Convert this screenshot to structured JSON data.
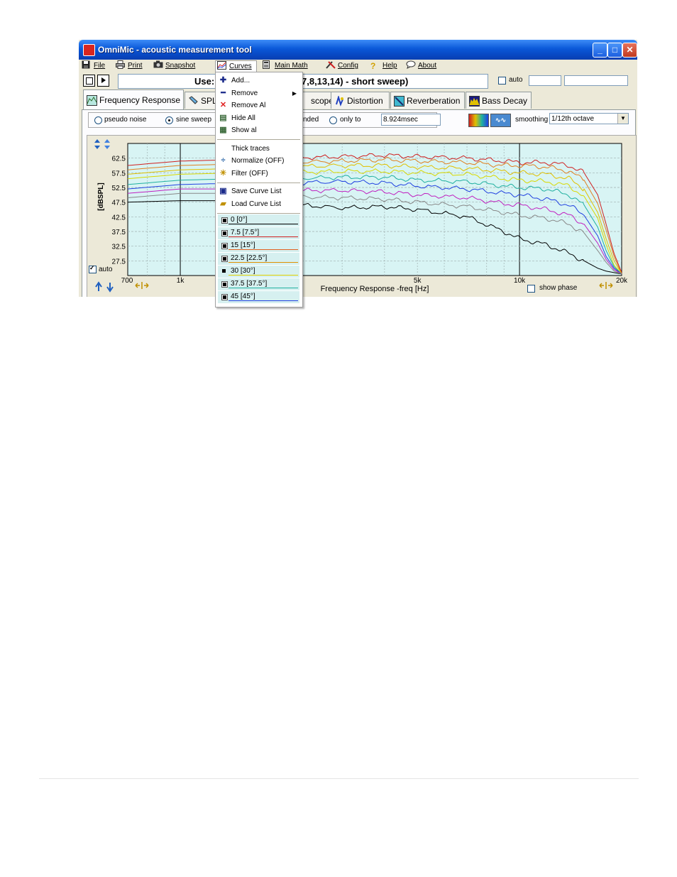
{
  "window": {
    "title": "OmniMic - acoustic measurement tool",
    "controls": {
      "minimize": "_",
      "maximize": "□",
      "close": "✕"
    }
  },
  "menubar": {
    "items": [
      {
        "label": "File",
        "icon": "disk-icon"
      },
      {
        "label": "Print",
        "icon": "printer-icon"
      },
      {
        "label": "Snapshot",
        "icon": "camera-icon"
      },
      {
        "label": "Curves",
        "icon": "curves-icon"
      },
      {
        "label": "Main Math",
        "icon": "calculator-icon"
      },
      {
        "label": "Config",
        "icon": "tools-icon"
      },
      {
        "label": "Help",
        "icon": "question-icon"
      },
      {
        "label": "About",
        "icon": "speech-bubble-icon"
      }
    ]
  },
  "toolbar": {
    "status_left": "Use:",
    "status_right": "7,8,13,14) - short sweep)",
    "auto_label": "auto"
  },
  "tabs": [
    {
      "label": "Frequency Response",
      "active": true
    },
    {
      "label": "SPL"
    },
    {
      "label": "scope"
    },
    {
      "label": "Distortion"
    },
    {
      "label": "Reverberation"
    },
    {
      "label": "Bass Decay"
    }
  ],
  "options": {
    "pseudo_noise": "pseudo noise",
    "sine_sweep": "sine sweep",
    "ded": "nded",
    "only_to": "only to",
    "time_value": "8.924msec",
    "smoothing_label": "smoothing",
    "smoothing_value": "1/12th octave"
  },
  "chart": {
    "auto_label": "auto",
    "show_phase": "show phase",
    "start_label": "700"
  },
  "chart_data": {
    "type": "line",
    "title": "",
    "xlabel": "Frequency Response -freq [Hz]",
    "ylabel": "[dBSPL]",
    "x_scale": "log",
    "xlim": [
      700,
      20000
    ],
    "ylim": [
      22.5,
      67.5
    ],
    "x_ticks": [
      {
        "value": 1000,
        "label": "1k"
      },
      {
        "value": 5000,
        "label": "5k"
      },
      {
        "value": 10000,
        "label": "10k"
      },
      {
        "value": 20000,
        "label": "20k"
      }
    ],
    "y_ticks": [
      62.5,
      57.5,
      52.5,
      47.5,
      42.5,
      37.5,
      32.5,
      27.5
    ],
    "grid": true,
    "x": [
      700,
      1000,
      1500,
      2000,
      3000,
      4000,
      5000,
      7000,
      9000,
      10000,
      12000,
      14000,
      15500,
      17000,
      18000,
      19000,
      20000
    ],
    "series": [
      {
        "name": "0 [0°]",
        "color": "#000000",
        "values": [
          47.5,
          48.0,
          48.0,
          47.0,
          45.5,
          46.0,
          45.0,
          42.5,
          37.5,
          35.0,
          33.0,
          30.0,
          27.5,
          25.0,
          24.0,
          23.5,
          23.0
        ]
      },
      {
        "name": "7.5 [7.5°]",
        "color": "#d02020",
        "values": [
          60.0,
          61.5,
          62.0,
          62.5,
          63.0,
          63.5,
          63.0,
          62.5,
          61.5,
          61.0,
          61.0,
          60.0,
          57.5,
          50.0,
          40.0,
          30.0,
          23.5
        ]
      },
      {
        "name": "15 [15°]",
        "color": "#e08020",
        "values": [
          58.5,
          60.0,
          60.5,
          61.0,
          61.5,
          62.0,
          61.5,
          61.0,
          60.0,
          60.0,
          59.5,
          58.0,
          55.0,
          47.0,
          38.0,
          29.0,
          23.0
        ]
      },
      {
        "name": "22.5 [22.5°]",
        "color": "#e0c000",
        "values": [
          57.0,
          58.5,
          59.0,
          59.5,
          60.0,
          60.0,
          59.5,
          59.0,
          58.0,
          57.5,
          57.0,
          55.5,
          52.0,
          44.0,
          35.0,
          27.5,
          23.0
        ]
      },
      {
        "name": "30 [30°]",
        "color": "#d8d800",
        "values": [
          55.5,
          57.0,
          57.5,
          57.5,
          58.0,
          58.0,
          57.5,
          57.0,
          55.5,
          55.0,
          54.5,
          53.0,
          49.5,
          42.0,
          33.0,
          26.0,
          23.0
        ]
      },
      {
        "name": "37.5 [37.5°]",
        "color": "#20b0a0",
        "values": [
          53.5,
          55.0,
          55.5,
          55.5,
          56.0,
          56.0,
          55.0,
          54.5,
          53.0,
          52.5,
          52.0,
          50.0,
          46.5,
          39.0,
          31.0,
          25.5,
          23.0
        ]
      },
      {
        "name": "45 [45°]",
        "color": "#2040e0",
        "values": [
          52.0,
          53.5,
          54.0,
          54.0,
          54.5,
          54.0,
          53.0,
          52.0,
          50.5,
          50.0,
          48.5,
          46.5,
          43.0,
          36.0,
          29.0,
          25.0,
          23.0
        ]
      },
      {
        "name": "",
        "color": "#c020c0",
        "values": [
          50.5,
          52.0,
          52.0,
          51.5,
          51.5,
          51.0,
          50.0,
          49.0,
          47.0,
          46.5,
          45.0,
          43.0,
          40.0,
          33.5,
          28.0,
          24.5,
          23.0
        ]
      },
      {
        "name": "",
        "color": "#888888",
        "values": [
          49.0,
          50.5,
          50.5,
          49.5,
          49.0,
          48.5,
          47.5,
          46.0,
          44.0,
          43.0,
          42.0,
          40.0,
          37.0,
          31.0,
          27.0,
          24.0,
          23.0
        ]
      }
    ]
  },
  "curves_menu": {
    "items": [
      {
        "label": "Add...",
        "icon": "plus-icon",
        "glyph": "✚",
        "color": "#1a2a8a"
      },
      {
        "label": "Remove",
        "icon": "minus-icon",
        "glyph": "━",
        "color": "#1a2a8a",
        "submenu": true
      },
      {
        "label": "Remove Al",
        "icon": "red-x-icon",
        "glyph": "✕",
        "color": "#e02020"
      },
      {
        "label": "Hide All",
        "icon": "hide-all-icon",
        "glyph": "▤",
        "color": "#3a6a3a"
      },
      {
        "label": "Show al",
        "icon": "show-all-icon",
        "glyph": "▦",
        "color": "#3a6a3a"
      },
      {
        "label": "Thick traces",
        "icon": "",
        "glyph": "",
        "color": "#000"
      },
      {
        "label": "Normalize (OFF)",
        "icon": "normalize-icon",
        "glyph": "÷",
        "color": "#1a5aa0"
      },
      {
        "label": "Filter (OFF)",
        "icon": "filter-icon",
        "glyph": "✳",
        "color": "#c09000"
      },
      {
        "label": "Save Curve List",
        "icon": "save-list-icon",
        "glyph": "▣",
        "color": "#1a2a8a"
      },
      {
        "label": "Load Curve List",
        "icon": "load-list-icon",
        "glyph": "▰",
        "color": "#c09000"
      }
    ],
    "curves": [
      {
        "label": "0 [0°]",
        "color": "#000000"
      },
      {
        "label": "7.5 [7.5°]",
        "color": "#d02020"
      },
      {
        "label": "15 [15°]",
        "color": "#e06020"
      },
      {
        "label": "22.5 [22.5°]",
        "color": "#e09000"
      },
      {
        "label": "30 [30°]",
        "color": "#e0d000"
      },
      {
        "label": "37.5 [37.5°]",
        "color": "#20b0a0"
      },
      {
        "label": "45 [45°]",
        "color": "#2040e0"
      }
    ]
  }
}
